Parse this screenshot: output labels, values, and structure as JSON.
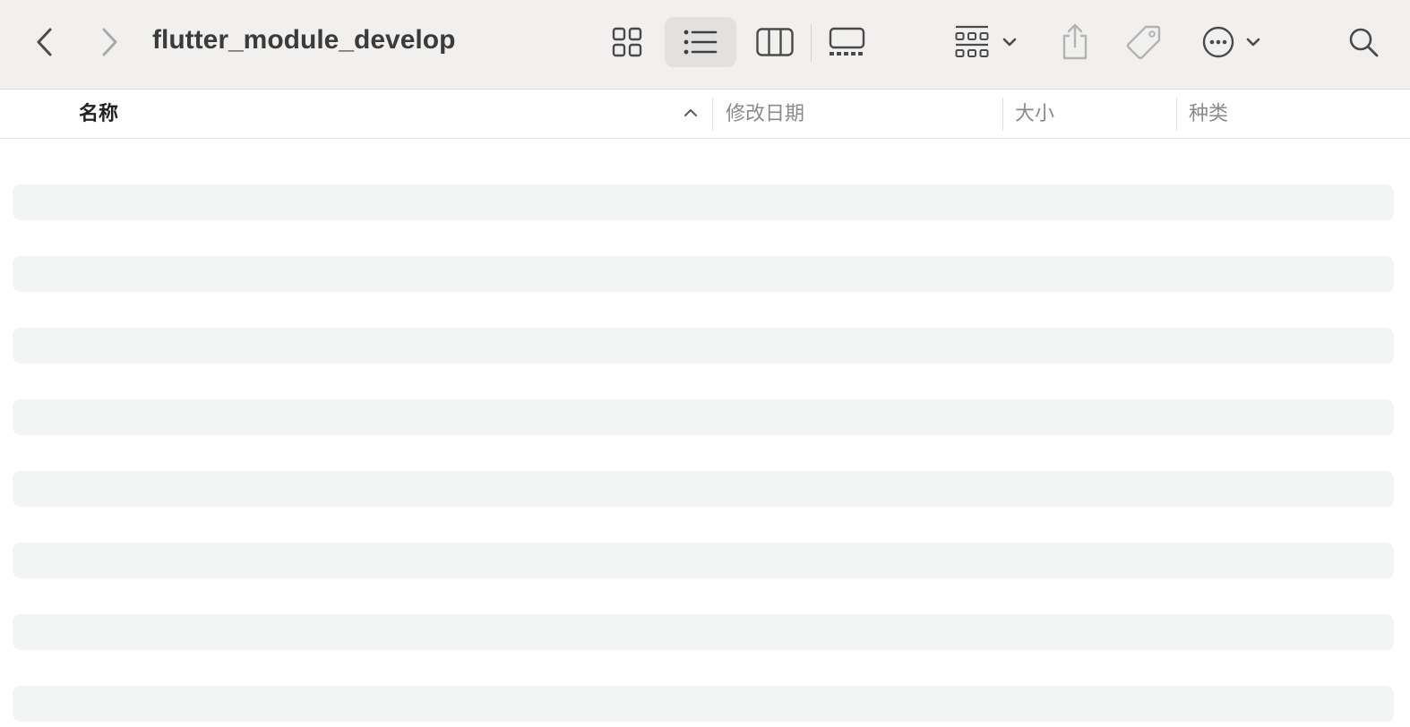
{
  "toolbar": {
    "back_icon": "chevron-left-icon",
    "forward_icon": "chevron-right-icon",
    "title": "flutter_module_develop",
    "views": [
      {
        "icon": "icon-view-grid-icon",
        "active": false
      },
      {
        "icon": "list-view-icon",
        "active": true
      },
      {
        "icon": "column-view-icon",
        "active": false
      },
      {
        "icon": "gallery-view-icon",
        "active": false
      }
    ],
    "group_icon": "group-by-icon",
    "share_icon": "share-icon",
    "tag_icon": "tag-icon",
    "more_icon": "ellipsis-circle-icon",
    "search_icon": "search-icon"
  },
  "columns": {
    "name": "名称",
    "date_modified": "修改日期",
    "size": "大小",
    "kind": "种类",
    "sort": "ascending"
  },
  "placeholder_rows": 8,
  "colors": {
    "toolbar_bg": "#f1f0ef",
    "active_view_bg": "#e2e1e0",
    "row_placeholder": "#f3f4f4",
    "icon": "#4a4a4a",
    "icon_disabled": "#b3b3b3"
  }
}
